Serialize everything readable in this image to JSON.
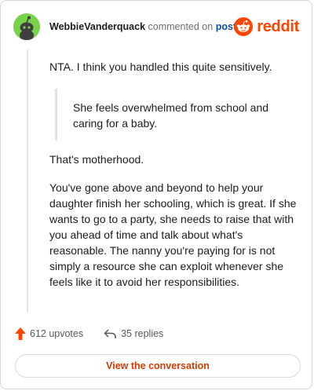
{
  "header": {
    "username": "WebbieVanderquack",
    "commented_text": "commented on",
    "post_link": "post",
    "brand": "reddit",
    "avatar_icon": "snoo-avatar-icon",
    "brand_icon": "reddit-logo-icon"
  },
  "comment": {
    "paragraph1": "NTA. I think you handled this quite sensitively.",
    "quote": "She feels overwhelmed from school and caring for a baby.",
    "paragraph2": "That's motherhood.",
    "paragraph3": "You've gone above and beyond to help your daughter finish her schooling, which is great. If she wants to go to a party, she needs to raise that with you ahead of time and talk about what's reasonable. The nanny you're paying for is not simply a resource she can exploit whenever she feels like it to avoid her responsibilities."
  },
  "footer": {
    "upvotes": "612 upvotes",
    "replies": "35 replies",
    "upvote_icon": "upvote-arrow-icon",
    "reply_icon": "reply-arrow-icon",
    "cta": "View the conversation"
  },
  "colors": {
    "brand": "#ff4500",
    "link": "#0a4f9f",
    "cta": "#d93a00",
    "avatar": "#7ad14a"
  }
}
